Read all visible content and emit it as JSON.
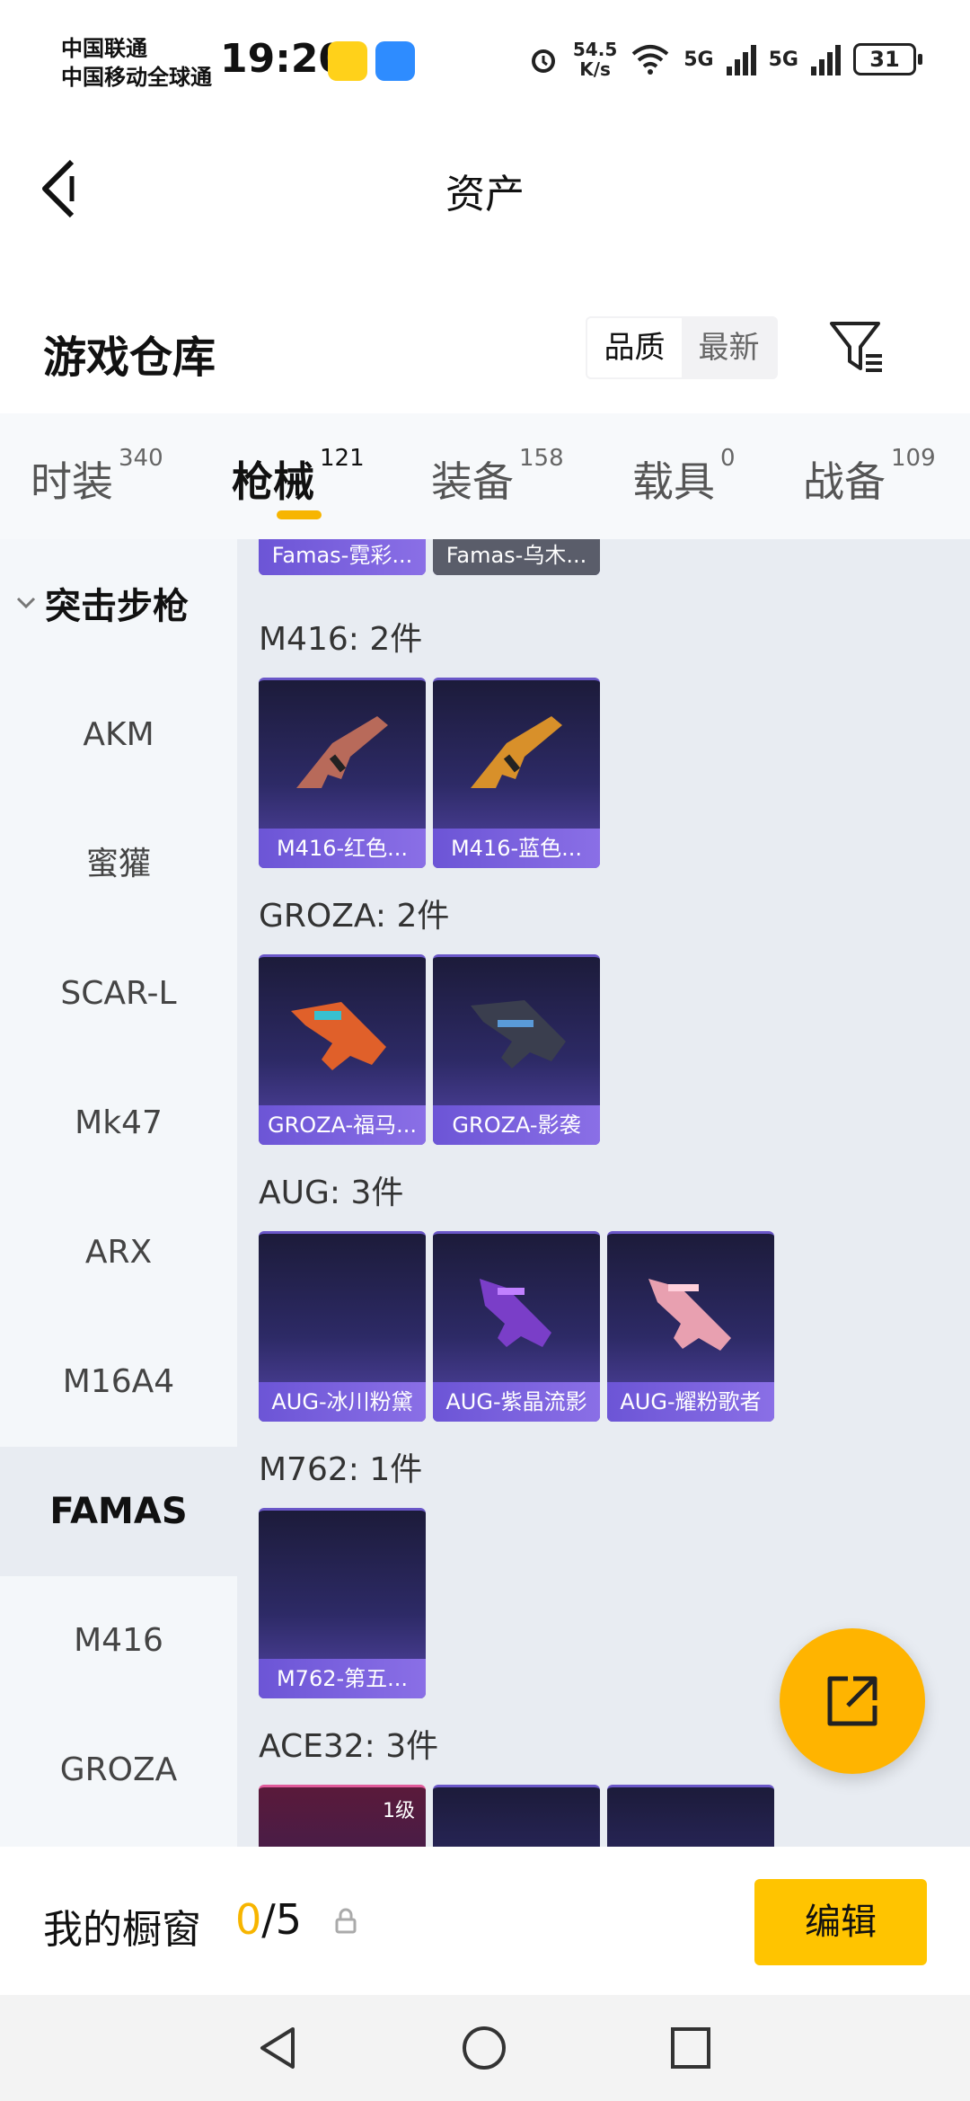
{
  "status_bar": {
    "carrier1": "中国联通",
    "carrier2": "中国移动全球通",
    "time": "19:20",
    "speed_top": "54.5",
    "speed_bottom": "K/s",
    "net1": "5G",
    "net2": "5G",
    "battery": "31"
  },
  "header": {
    "title": "资产"
  },
  "warehouse": {
    "title": "游戏仓库",
    "sort_options": [
      "品质",
      "最新"
    ],
    "sort_selected": "品质"
  },
  "tabs": [
    {
      "label": "时装",
      "count": "340"
    },
    {
      "label": "枪械",
      "count": "121",
      "active": true
    },
    {
      "label": "装备",
      "count": "158"
    },
    {
      "label": "载具",
      "count": "0"
    },
    {
      "label": "战备",
      "count": "109"
    }
  ],
  "sidebar": {
    "category": "突击步枪",
    "items": [
      "AKM",
      "蜜獾",
      "SCAR-L",
      "Mk47",
      "ARX",
      "M16A4",
      "FAMAS",
      "M416",
      "GROZA"
    ],
    "active": "FAMAS"
  },
  "groups": [
    {
      "title": "",
      "items": [
        "Famas-霓彩...",
        "Famas-乌木..."
      ]
    },
    {
      "title": "M416: 2件",
      "items": [
        "M416-红色...",
        "M416-蓝色..."
      ]
    },
    {
      "title": "GROZA: 2件",
      "items": [
        "GROZA-福马...",
        "GROZA-影袭"
      ]
    },
    {
      "title": "AUG: 3件",
      "items": [
        "AUG-冰川粉黛",
        "AUG-紫晶流影",
        "AUG-耀粉歌者"
      ]
    },
    {
      "title": "M762: 1件",
      "items": [
        "M762-第五..."
      ]
    },
    {
      "title": "ACE32: 3件",
      "items": [
        "",
        "",
        ""
      ],
      "badge": "1级"
    }
  ],
  "showcase": {
    "label": "我的橱窗",
    "current": "0",
    "total": "/5",
    "edit_label": "编辑"
  },
  "colors": {
    "accent": "#f7b500",
    "card_label": "#6c55d6"
  }
}
